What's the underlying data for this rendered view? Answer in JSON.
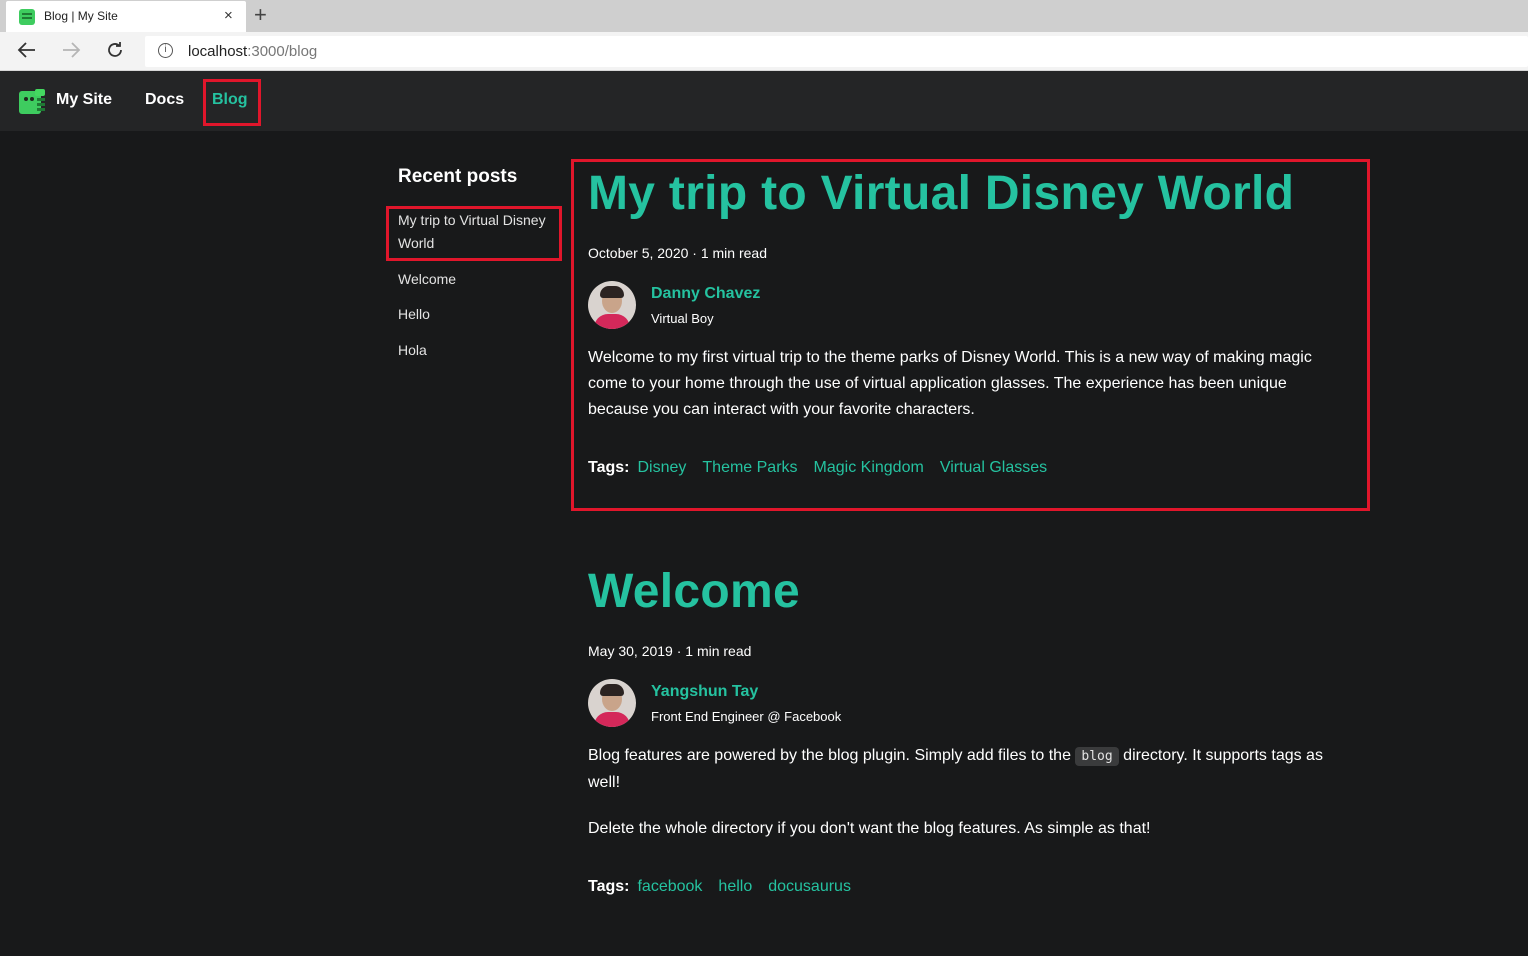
{
  "browser": {
    "tab_title": "Blog | My Site",
    "tab_close": "×",
    "new_tab": "+",
    "url_host": "localhost",
    "url_path": ":3000/blog"
  },
  "navbar": {
    "brand": "My Site",
    "links": [
      "Docs",
      "Blog"
    ],
    "active": "Blog"
  },
  "sidebar": {
    "title": "Recent posts",
    "items": [
      "My trip to Virtual Disney World",
      "Welcome",
      "Hello",
      "Hola"
    ]
  },
  "posts": [
    {
      "title": "My trip to Virtual Disney World",
      "meta": "October 5, 2020 · 1 min read",
      "author": "Danny Chavez",
      "author_role": "Virtual Boy",
      "paragraphs": [
        "Welcome to my first virtual trip to the theme parks of Disney World. This is a new way of making magic come to your home through the use of virtual application glasses. The experience has been unique because you can interact with your favorite characters."
      ],
      "tags_label": "Tags:",
      "tags": [
        "Disney",
        "Theme Parks",
        "Magic Kingdom",
        "Virtual Glasses"
      ]
    },
    {
      "title": "Welcome",
      "meta": "May 30, 2019 · 1 min read",
      "author": "Yangshun Tay",
      "author_role": "Front End Engineer @ Facebook",
      "p1_before": "Blog features are powered by the blog plugin. Simply add files to the ",
      "p1_code": "blog",
      "p1_after": " directory. It supports tags as well!",
      "p2": "Delete the whole directory if you don't want the blog features. As simple as that!",
      "tags_label": "Tags:",
      "tags": [
        "facebook",
        "hello",
        "docusaurus"
      ]
    }
  ],
  "colors": {
    "accent": "#25c2a0",
    "background": "#18191a",
    "navbar": "#242526",
    "highlight": "#e0162b"
  }
}
